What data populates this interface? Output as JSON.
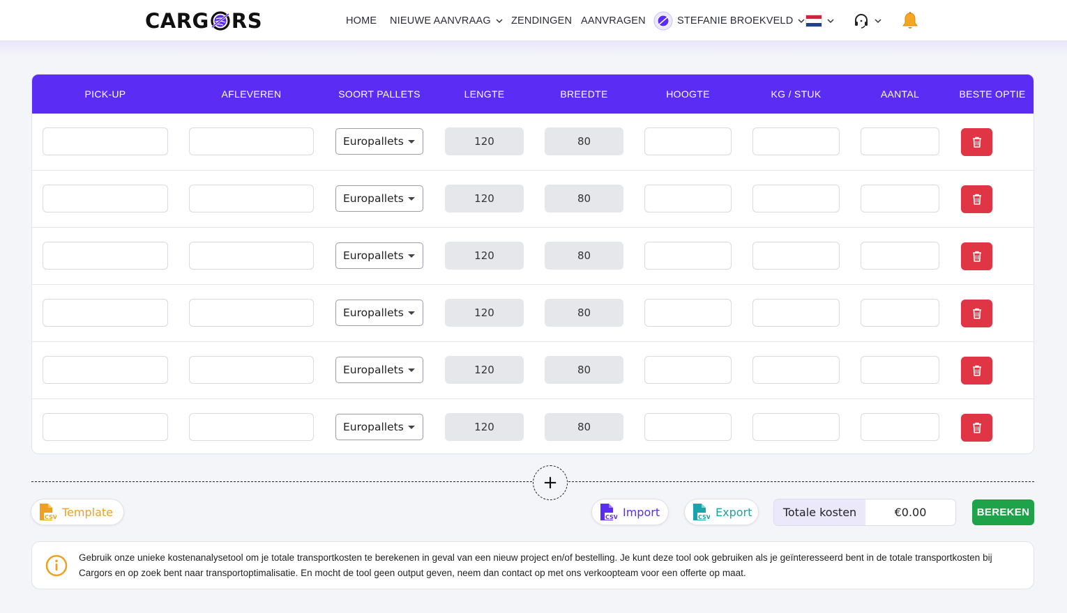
{
  "header": {
    "logo_left": "CARG",
    "logo_right": "RS",
    "nav": {
      "home": "HOME",
      "new_request": "NIEUWE AANVRAAG",
      "shipments": "ZENDINGEN",
      "requests": "AANVRAGEN",
      "user": "STEFANIE BROEKVELD"
    }
  },
  "table": {
    "columns": [
      "PICK-UP",
      "AFLEVEREN",
      "SOORT PALLETS",
      "LENGTE",
      "BREEDTE",
      "HOOGTE",
      "KG / STUK",
      "AANTAL",
      "BESTE OPTIE"
    ],
    "rows": [
      {
        "pallet": "Europallets",
        "length": "120",
        "width": "80"
      },
      {
        "pallet": "Europallets",
        "length": "120",
        "width": "80"
      },
      {
        "pallet": "Europallets",
        "length": "120",
        "width": "80"
      },
      {
        "pallet": "Europallets",
        "length": "120",
        "width": "80"
      },
      {
        "pallet": "Europallets",
        "length": "120",
        "width": "80"
      },
      {
        "pallet": "Europallets",
        "length": "120",
        "width": "80"
      }
    ]
  },
  "actions": {
    "add": "+",
    "template": "Template",
    "import": "Import",
    "export": "Export",
    "csv": "CSV",
    "total_label": "Totale kosten",
    "total_value": "€0.00",
    "calculate": "BEREKEN"
  },
  "info": {
    "text": "Gebruik onze unieke kostenanalysetool om je totale transportkosten te berekenen in geval van een nieuw project en/of bestelling. Je kunt deze tool ook gebruiken als je geïnteresseerd bent in de totale transportkosten bij Cargors en op zoek bent naar transportoptimalisatie. En mocht de tool geen output geven, neem dan contact op met ons verkoopteam voor een offerte op maat."
  },
  "colors": {
    "accent": "#5b2cf3",
    "danger": "#e03545",
    "success": "#1ea34b",
    "template": "#f0a020",
    "export": "#1aa3a8"
  }
}
